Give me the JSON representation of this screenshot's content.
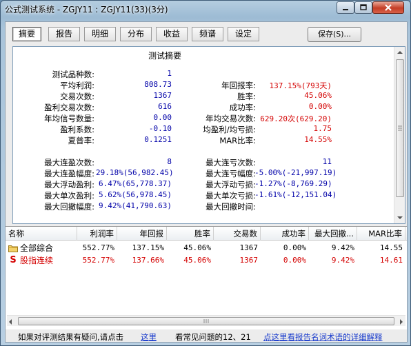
{
  "window": {
    "title": "公式测试系统 - ZGJY11 : ZGJY11(33)(3分)"
  },
  "tabs": [
    "摘要",
    "报告",
    "明细",
    "分布",
    "收益",
    "频谱",
    "设定"
  ],
  "save_label": "保存(S)...",
  "summary": {
    "title": "测试摘要",
    "left": [
      {
        "label": "测试品种数:",
        "value": "1"
      },
      {
        "label": "平均利润:",
        "value": "808.73"
      },
      {
        "label": "交易次数:",
        "value": "1367"
      },
      {
        "label": "盈利交易次数:",
        "value": "616"
      },
      {
        "label": "年均信号数量:",
        "value": "0.00"
      },
      {
        "label": "盈利系数:",
        "value": "-0.10"
      },
      {
        "label": "夏普率:",
        "value": "0.1251"
      }
    ],
    "right": [
      {
        "label": "年回报率:",
        "value": "137.15%(793天)"
      },
      {
        "label": "胜率:",
        "value": "45.06%"
      },
      {
        "label": "成功率:",
        "value": "0.00%"
      },
      {
        "label": "年均交易次数:",
        "value": "629.20次(629.20)"
      },
      {
        "label": "均盈利/均亏损:",
        "value": "1.75"
      },
      {
        "label": "MAR比率:",
        "value": "14.55%"
      }
    ],
    "left2": [
      {
        "label": "最大连盈次数:",
        "value": "8"
      },
      {
        "label": "最大连盈幅度:",
        "value": "29.18%(56,982.45)"
      },
      {
        "label": "最大浮动盈利:",
        "value": "6.47%(65,778.37)"
      },
      {
        "label": "最大单次盈利:",
        "value": "5.62%(56,978.45)"
      },
      {
        "label": "最大回撤幅度:",
        "value": "9.42%(41,790.63)"
      }
    ],
    "right2": [
      {
        "label": "最大连亏次数:",
        "value": "11"
      },
      {
        "label": "最大连亏幅度:",
        "value": "-5.00%(-21,997.19)"
      },
      {
        "label": "最大浮动亏损:",
        "value": "-1.27%(-8,769.29)"
      },
      {
        "label": "最大单次亏损:",
        "value": "-1.61%(-12,151.04)"
      },
      {
        "label": "最大回撤时间:",
        "value": ""
      }
    ]
  },
  "table": {
    "headers": [
      "名称",
      "利润率",
      "年回报",
      "胜率",
      "交易数",
      "成功率",
      "最大回撤...",
      "MAR比率"
    ],
    "rows": [
      {
        "name": "全部综合",
        "icon": "folder-icon",
        "cells": [
          "552.77%",
          "137.15%",
          "45.06%",
          "1367",
          "0.00%",
          "9.42%",
          "14.55"
        ]
      },
      {
        "name": "股指连续",
        "icon": "s-icon",
        "icon_text": "S",
        "cells": [
          "552.77%",
          "137.66%",
          "45.06%",
          "1367",
          "0.00%",
          "9.42%",
          "14.61"
        ]
      }
    ]
  },
  "footer": {
    "question": "如果对评测结果有疑问,请点击",
    "here_link": "这里",
    "faq": "看常见问题的12、21",
    "glossary_link": "点这里看报告名词术语的详细解释"
  },
  "colors": {
    "positive": "#d40000",
    "neutral": "#0000a8",
    "link": "#1a3ccc"
  }
}
